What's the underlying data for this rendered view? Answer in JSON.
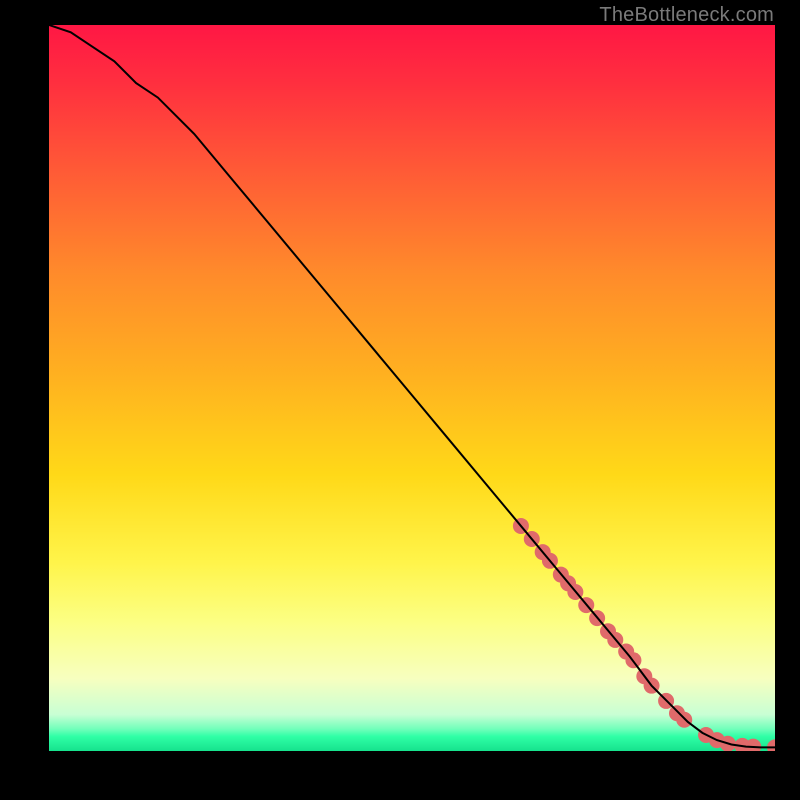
{
  "attribution": "TheBottleneck.com",
  "chart_data": {
    "type": "line",
    "title": "",
    "xlabel": "",
    "ylabel": "",
    "xlim": [
      0,
      100
    ],
    "ylim": [
      0,
      100
    ],
    "grid": false,
    "legend": false,
    "series": [
      {
        "name": "curve",
        "color": "#000000",
        "x": [
          0,
          3,
          6,
          9,
          12,
          15,
          20,
          25,
          30,
          35,
          40,
          45,
          50,
          55,
          60,
          65,
          70,
          75,
          80,
          83,
          86,
          88,
          90,
          92,
          94,
          96,
          98,
          100
        ],
        "y": [
          100,
          99,
          97,
          95,
          92,
          90,
          85,
          79,
          73,
          67,
          61,
          55,
          49,
          43,
          37,
          31,
          25,
          19,
          13,
          9,
          6,
          4,
          2.5,
          1.5,
          0.9,
          0.6,
          0.5,
          0.5
        ]
      }
    ],
    "markers": {
      "name": "dots",
      "color": "#e06a6a",
      "radius_px": 8,
      "points": [
        {
          "x": 65.0,
          "y": 31.0
        },
        {
          "x": 66.5,
          "y": 29.2
        },
        {
          "x": 68.0,
          "y": 27.4
        },
        {
          "x": 69.0,
          "y": 26.2
        },
        {
          "x": 70.5,
          "y": 24.3
        },
        {
          "x": 71.5,
          "y": 23.1
        },
        {
          "x": 72.5,
          "y": 21.9
        },
        {
          "x": 74.0,
          "y": 20.1
        },
        {
          "x": 75.5,
          "y": 18.3
        },
        {
          "x": 77.0,
          "y": 16.5
        },
        {
          "x": 78.0,
          "y": 15.3
        },
        {
          "x": 79.5,
          "y": 13.7
        },
        {
          "x": 80.5,
          "y": 12.5
        },
        {
          "x": 82.0,
          "y": 10.3
        },
        {
          "x": 83.0,
          "y": 9.0
        },
        {
          "x": 85.0,
          "y": 6.9
        },
        {
          "x": 86.5,
          "y": 5.2
        },
        {
          "x": 87.5,
          "y": 4.3
        },
        {
          "x": 90.5,
          "y": 2.2
        },
        {
          "x": 92.0,
          "y": 1.5
        },
        {
          "x": 93.5,
          "y": 1.0
        },
        {
          "x": 95.5,
          "y": 0.7
        },
        {
          "x": 97.0,
          "y": 0.6
        },
        {
          "x": 100.0,
          "y": 0.5
        }
      ]
    }
  }
}
